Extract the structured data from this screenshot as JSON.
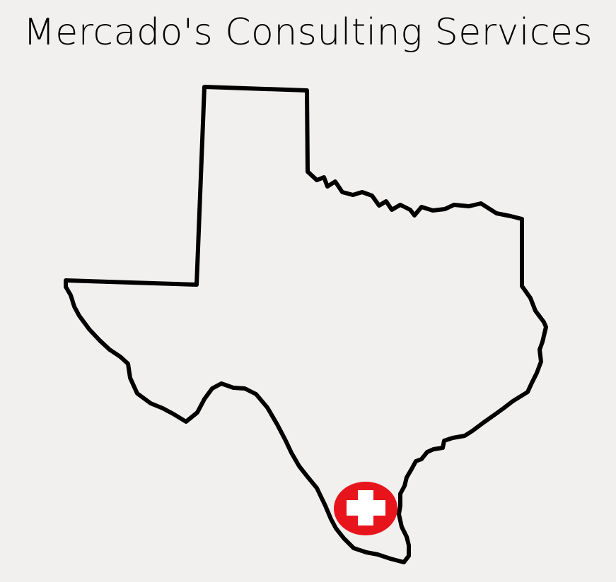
{
  "title": "Mercado's Consulting Services",
  "colors": {
    "background": "#f2f0ef",
    "outline": "#000000",
    "marker": "#e8141c",
    "marker_cross": "#ffffff"
  },
  "icons": {
    "marker": "medical-cross-icon",
    "state": "texas-outline"
  }
}
